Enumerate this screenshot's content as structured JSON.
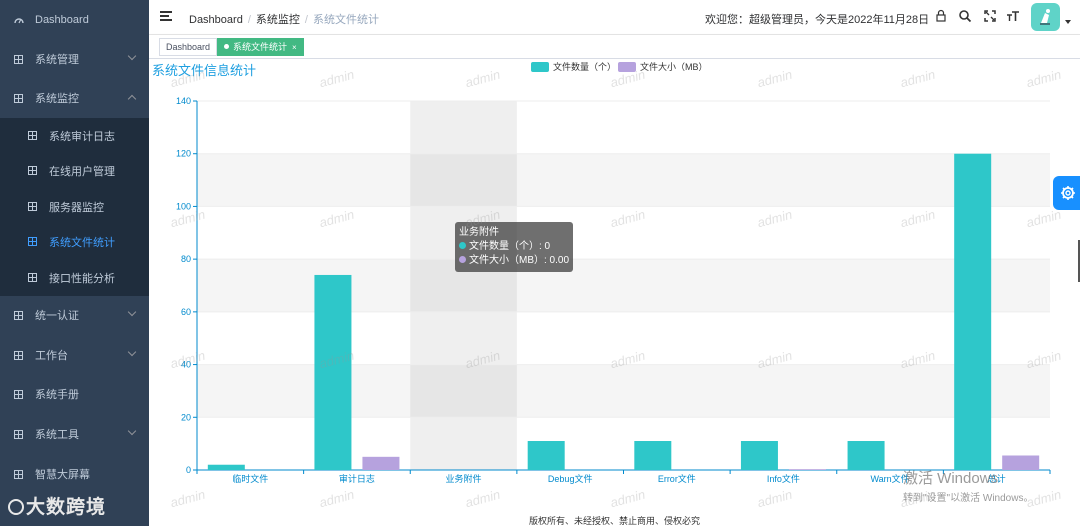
{
  "sidebar": {
    "dashboard": "Dashboard",
    "items": [
      {
        "label": "系统管理"
      },
      {
        "label": "系统监控"
      },
      {
        "label": "统一认证"
      },
      {
        "label": "工作台"
      },
      {
        "label": "系统手册"
      },
      {
        "label": "系统工具"
      },
      {
        "label": "智慧大屏幕"
      }
    ],
    "submenu": [
      {
        "label": "系统审计日志"
      },
      {
        "label": "在线用户管理"
      },
      {
        "label": "服务器监控"
      },
      {
        "label": "系统文件统计"
      },
      {
        "label": "接口性能分析"
      }
    ],
    "brand": "大数跨境"
  },
  "navbar": {
    "breadcrumb": [
      "Dashboard",
      "系统监控",
      "系统文件统计"
    ],
    "welcome": "欢迎您：超级管理员，今天是2022年11月28日"
  },
  "tags": {
    "dashboard": "Dashboard",
    "active": "系统文件统计",
    "close": "×"
  },
  "chart_data": {
    "type": "bar",
    "title": "系统文件信息统计",
    "categories": [
      "临时文件",
      "审计日志",
      "业务附件",
      "Debug文件",
      "Error文件",
      "Info文件",
      "Warn文件",
      "总计"
    ],
    "series": [
      {
        "name": "文件数量（个）",
        "color": "#2ec7c9",
        "values": [
          2,
          74,
          0,
          11,
          11,
          11,
          11,
          120
        ]
      },
      {
        "name": "文件大小（MB）",
        "color": "#b6a2de",
        "values": [
          0,
          5,
          0,
          0,
          0,
          0.3,
          0,
          5.5
        ]
      }
    ],
    "ylim": [
      0,
      140
    ],
    "yticks": [
      0,
      20,
      40,
      60,
      80,
      100,
      120,
      140
    ],
    "legend": "top-center",
    "highlight_category": "业务附件"
  },
  "tooltip": {
    "title": "业务附件",
    "line1": "文件数量（个）: 0",
    "line2": "文件大小（MB）: 0.00"
  },
  "footer": "版权所有、未经授权、禁止商用、侵权必究",
  "watermark": "admin",
  "os_watermark": {
    "line1": "激活 Windows",
    "line2": "转到\"设置\"以激活 Windows。"
  }
}
